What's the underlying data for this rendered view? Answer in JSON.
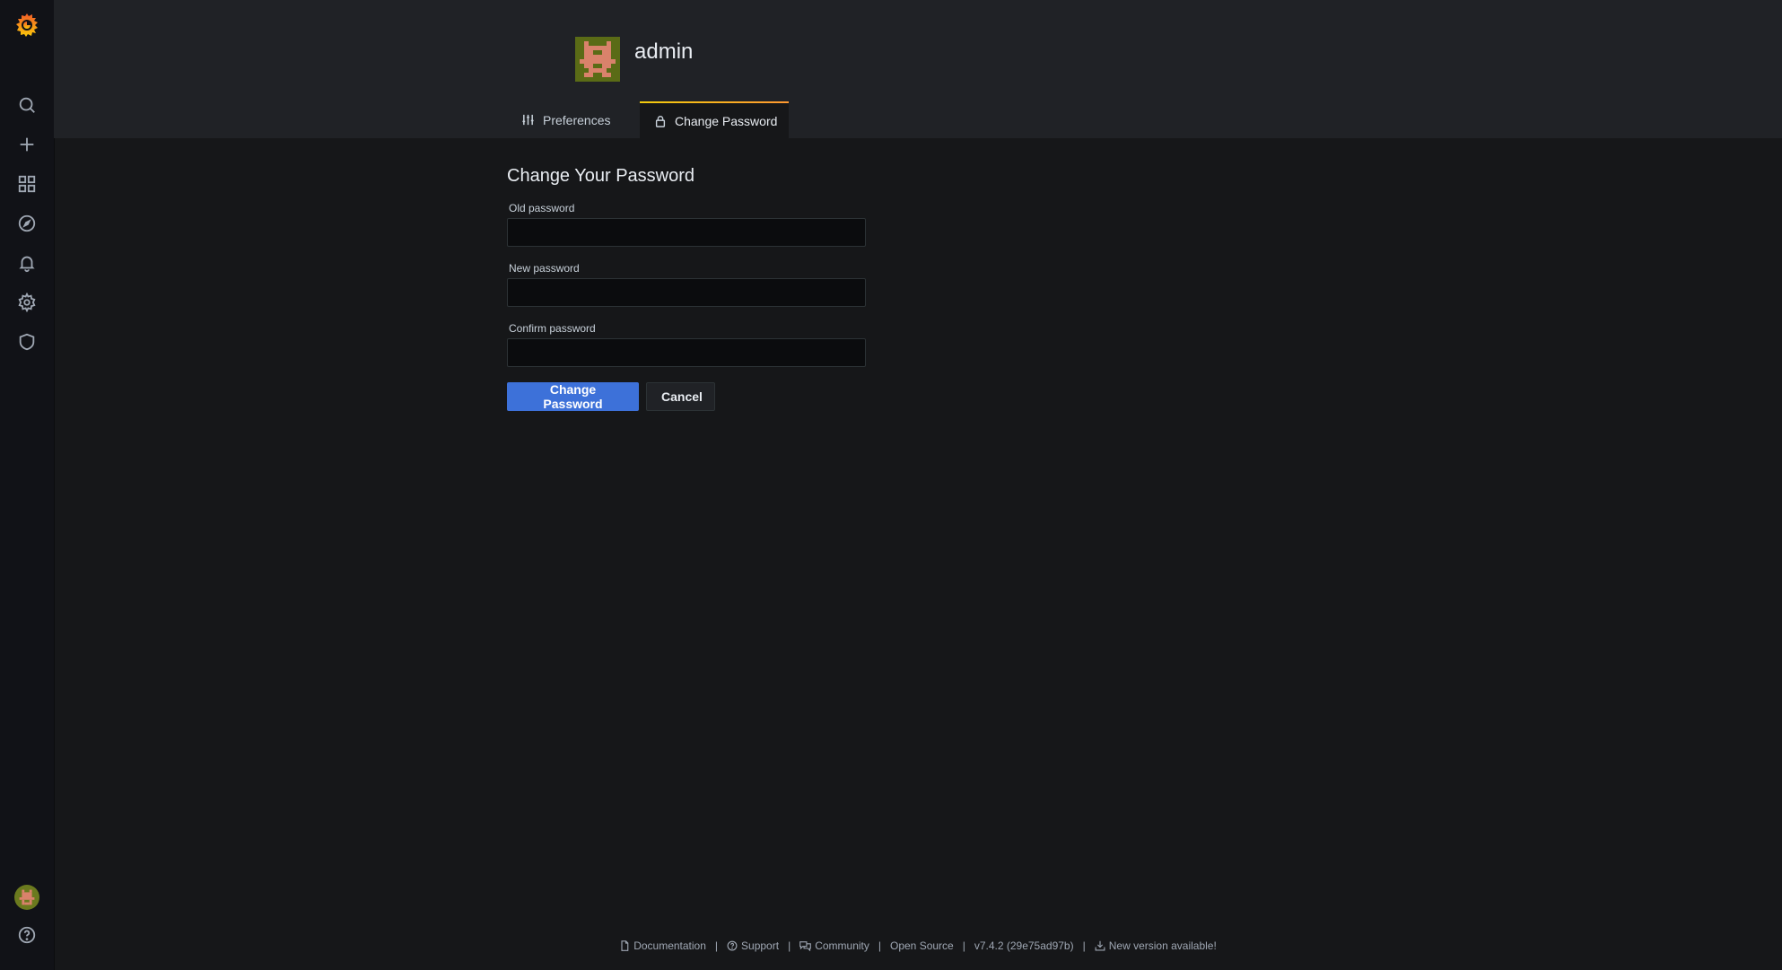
{
  "sidebar": {
    "logo_icon": "grafana-logo-icon",
    "items": [
      {
        "icon": "search-icon",
        "label": "Search"
      },
      {
        "icon": "plus-icon",
        "label": "Create"
      },
      {
        "icon": "dashboards-icon",
        "label": "Dashboards"
      },
      {
        "icon": "compass-icon",
        "label": "Explore"
      },
      {
        "icon": "bell-icon",
        "label": "Alerting"
      },
      {
        "icon": "gear-icon",
        "label": "Configuration"
      },
      {
        "icon": "shield-icon",
        "label": "Server Admin"
      }
    ],
    "bottom": [
      {
        "icon": "user-avatar-icon",
        "label": "Profile"
      },
      {
        "icon": "help-icon",
        "label": "Help"
      }
    ]
  },
  "header": {
    "username": "admin",
    "tabs": [
      {
        "label": "Preferences",
        "icon": "sliders-icon",
        "active": false
      },
      {
        "label": "Change Password",
        "icon": "lock-icon",
        "active": true
      }
    ]
  },
  "form": {
    "title": "Change Your Password",
    "fields": [
      {
        "label": "Old password",
        "value": "",
        "placeholder": ""
      },
      {
        "label": "New password",
        "value": "",
        "placeholder": ""
      },
      {
        "label": "Confirm password",
        "value": "",
        "placeholder": ""
      }
    ],
    "submit_label": "Change Password",
    "cancel_label": "Cancel"
  },
  "footer": {
    "documentation": "Documentation",
    "support": "Support",
    "community": "Community",
    "open_source": "Open Source",
    "version": "v7.4.2 (29e75ad97b)",
    "new_version": "New version available!"
  },
  "colors": {
    "accent": "#3d71d9",
    "tab_gradient_start": "#f2cc0c",
    "tab_gradient_end": "#ff9830",
    "logo": "#f46800"
  }
}
